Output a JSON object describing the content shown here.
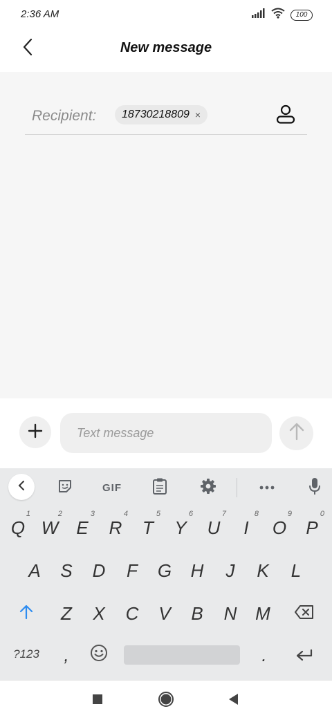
{
  "status_bar": {
    "time": "2:36 AM",
    "battery": "100"
  },
  "header": {
    "title": "New message"
  },
  "recipient": {
    "label": "Recipient:",
    "chip_number": "18730218809",
    "chip_remove": "×"
  },
  "compose": {
    "placeholder": "Text message"
  },
  "keyboard": {
    "toolbar": {
      "gif_label": "GIF"
    },
    "row1": [
      {
        "key": "Q",
        "hint": "1"
      },
      {
        "key": "W",
        "hint": "2"
      },
      {
        "key": "E",
        "hint": "3"
      },
      {
        "key": "R",
        "hint": "4"
      },
      {
        "key": "T",
        "hint": "5"
      },
      {
        "key": "Y",
        "hint": "6"
      },
      {
        "key": "U",
        "hint": "7"
      },
      {
        "key": "I",
        "hint": "8"
      },
      {
        "key": "O",
        "hint": "9"
      },
      {
        "key": "P",
        "hint": "0"
      }
    ],
    "row2": [
      "A",
      "S",
      "D",
      "F",
      "G",
      "H",
      "J",
      "K",
      "L"
    ],
    "row3": [
      "Z",
      "X",
      "C",
      "V",
      "B",
      "N",
      "M"
    ],
    "row4": {
      "num_switch": "?123",
      "comma": ",",
      "period": "."
    },
    "accent_color": "#2d8cf0"
  },
  "icons": {
    "back": "chevron-left-icon",
    "contacts": "contact-person-icon",
    "attach": "plus-icon",
    "send": "arrow-up-icon",
    "nav_recents": "square-icon",
    "nav_home": "circle-icon",
    "nav_back": "triangle-back-icon"
  }
}
